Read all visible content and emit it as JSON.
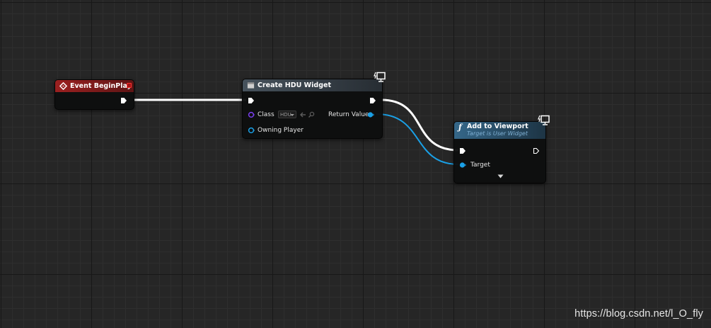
{
  "graph": {
    "background_color": "#262626"
  },
  "event_begin_play": {
    "title": "Event BeginPlay",
    "header_color": "#8a1b1b"
  },
  "create_widget": {
    "title": "Create HDU Widget",
    "class_label": "Class",
    "class_value": "HDU",
    "owning_player_label": "Owning Player",
    "return_value_label": "Return Value",
    "header_color": "#3e4850"
  },
  "add_to_viewport": {
    "title": "Add to Viewport",
    "subtitle": "Target is User Widget",
    "target_label": "Target",
    "header_color": "#2f5a7a"
  },
  "pin_colors": {
    "exec": "#ffffff",
    "object": "#1aa0e6",
    "class": "#7a3ff0"
  },
  "watermark": "https://blog.csdn.net/l_O_fly"
}
